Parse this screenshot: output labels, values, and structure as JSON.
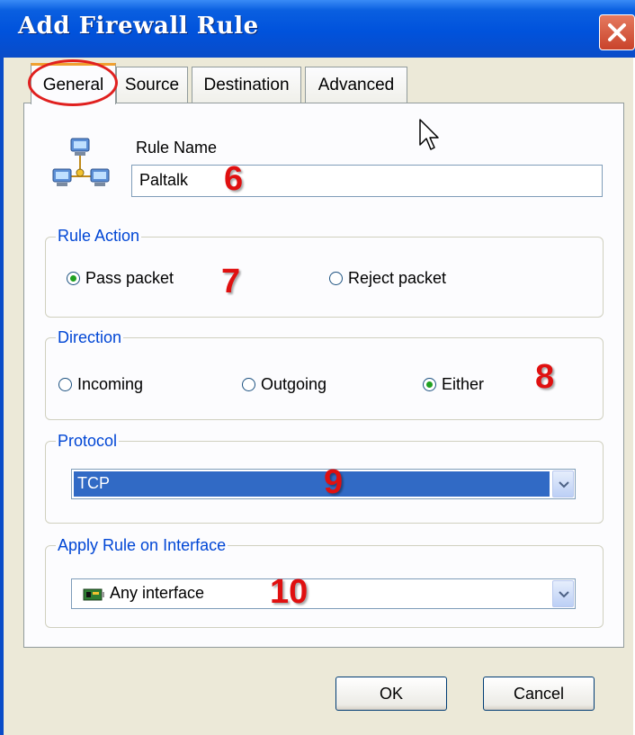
{
  "window": {
    "title": "Add Firewall Rule"
  },
  "tabs": [
    {
      "label": "General",
      "active": true
    },
    {
      "label": "Source"
    },
    {
      "label": "Destination"
    },
    {
      "label": "Advanced"
    }
  ],
  "general": {
    "rule_name_label": "Rule Name",
    "rule_name_value": "Paltalk",
    "rule_action": {
      "legend": "Rule Action",
      "options": [
        {
          "label": "Pass packet",
          "checked": true
        },
        {
          "label": "Reject packet",
          "checked": false
        }
      ]
    },
    "direction": {
      "legend": "Direction",
      "options": [
        {
          "label": "Incoming",
          "checked": false
        },
        {
          "label": "Outgoing",
          "checked": false
        },
        {
          "label": "Either",
          "checked": true
        }
      ]
    },
    "protocol": {
      "legend": "Protocol",
      "selected": "TCP"
    },
    "interface": {
      "legend": "Apply Rule on Interface",
      "selected": "Any interface",
      "icon": "network-card-icon"
    }
  },
  "annotations": [
    "6",
    "7",
    "8",
    "9",
    "10"
  ],
  "buttons": {
    "ok": "OK",
    "cancel": "Cancel"
  },
  "colors": {
    "title_bar": "#0052dc",
    "annotation": "#e01010",
    "selection": "#316ac5",
    "group_legend": "#0046d5"
  }
}
